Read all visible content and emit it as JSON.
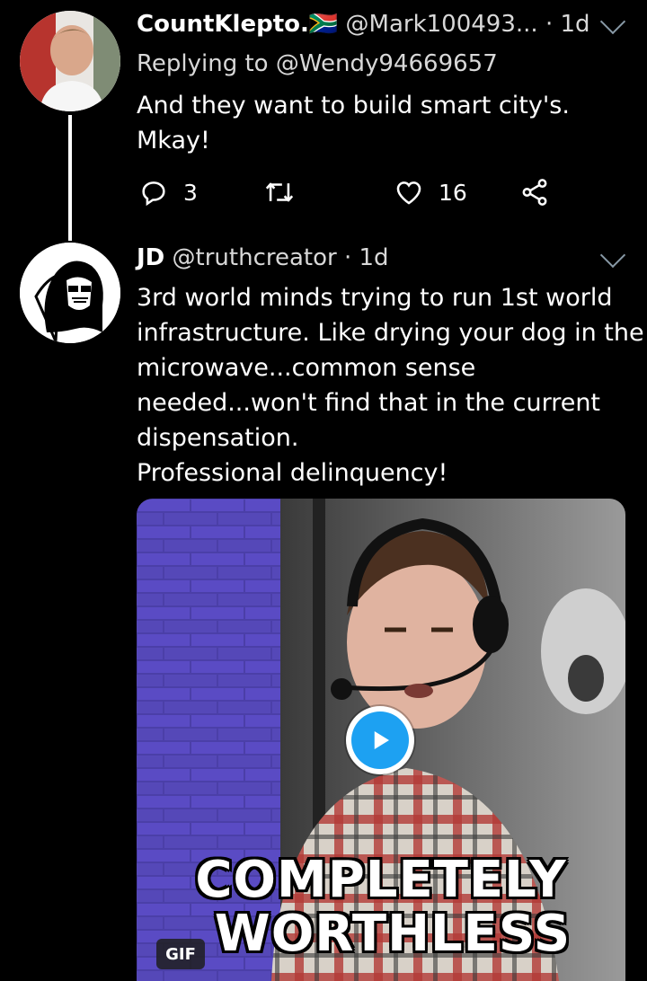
{
  "tweet1": {
    "display_name": "CountKlepto.",
    "flag": "🇿🇦",
    "handle": "@Mark100493...",
    "separator": "·",
    "time": "1d",
    "replying_to": "Replying to @Wendy94669657",
    "text_lines": [
      "And they want to build smart city's.",
      "Mkay!"
    ],
    "reply_count": "3",
    "retweet_count": "",
    "like_count": "16"
  },
  "tweet2": {
    "display_name": "JD",
    "handle": "@truthcreator",
    "separator": "·",
    "time": "1d",
    "text_lines": [
      "3rd world minds trying to run 1st world",
      "infrastructure. Like drying your dog in the",
      "microwave...common sense",
      "needed...won't find that in the current",
      "dispensation.",
      "Professional delinquency!"
    ],
    "media": {
      "caption_top": "COMPLETELY",
      "caption_bottom": "WORTHLESS",
      "badge": "GIF"
    }
  },
  "colors": {
    "background": "#000000",
    "secondary_text": "#d8d8d8",
    "accent": "#1da1f2",
    "icon": "#ffffff"
  },
  "icons": [
    "chevron-down-icon",
    "reply-icon",
    "retweet-icon",
    "like-icon",
    "share-icon",
    "play-icon"
  ]
}
